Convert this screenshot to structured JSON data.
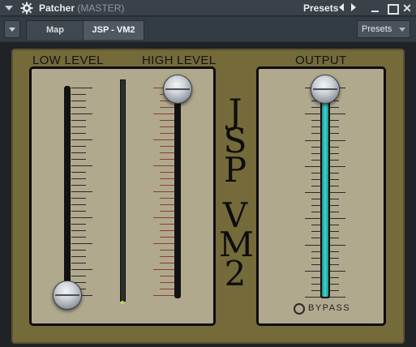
{
  "titlebar": {
    "title": "Patcher",
    "subtitle": "(MASTER)",
    "presets_label": "Presets"
  },
  "tabs": [
    {
      "label": "Map",
      "active": false
    },
    {
      "label": "JSP - VM2",
      "active": true
    }
  ],
  "tab_presets_label": "Presets",
  "plugin": {
    "brand_top": [
      "J",
      "S",
      "P"
    ],
    "brand_bottom": [
      "V",
      "M",
      "2"
    ],
    "low_level": {
      "label": "LOW LEVEL",
      "value_fraction": 0.0
    },
    "high_level": {
      "label": "HIGH LEVEL",
      "value_fraction": 1.0
    },
    "output": {
      "label": "OUTPUT",
      "value_fraction": 1.0,
      "fill_color": "#41d6cf"
    },
    "bypass": {
      "label": "BYPASS",
      "checked": false
    }
  },
  "colors": {
    "bezel": "#746a3a",
    "panel": "#b0a98e",
    "accent": "#41d6cf"
  }
}
